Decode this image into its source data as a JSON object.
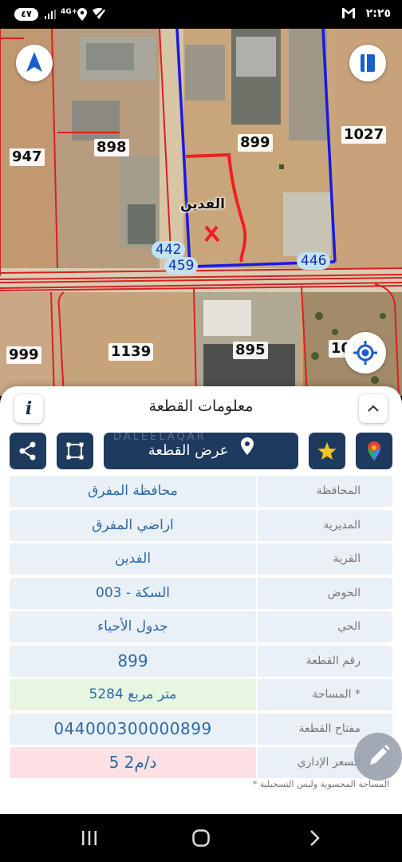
{
  "status_bar": {
    "time": "٢:٢٥",
    "battery": "٤٧",
    "network": "4G+",
    "icons": [
      "gmail-icon",
      "signal-icon",
      "location-icon",
      "wifi-off-icon"
    ]
  },
  "map": {
    "parcel_labels": [
      "947",
      "898",
      "899",
      "1027",
      "999",
      "1139",
      "895",
      "10"
    ],
    "village_label": "الفدين",
    "edge_labels": [
      "442",
      "459",
      "446"
    ],
    "colors": {
      "selected_parcel": "#ee2020",
      "boundary": "#1a1ae0",
      "parcel_lines": "#d82020",
      "edge_badge": "#bfe3f2"
    }
  },
  "sheet": {
    "title": "معلومات القطعة",
    "info_button": "i",
    "show_parcel_button": "عرض القطعة",
    "watermark": "DALEELAQAR",
    "rows": [
      {
        "label": "المحافظة",
        "value": "محافظة المفرق"
      },
      {
        "label": "المديرية",
        "value": "اراضي المفرق"
      },
      {
        "label": "القرية",
        "value": "الفدين"
      },
      {
        "label": "الحوض",
        "value": "السكة - 003"
      },
      {
        "label": "الحي",
        "value": "جدول الأحياء"
      },
      {
        "label": "رقم القطعة",
        "value": "899"
      },
      {
        "label": "المساحة *",
        "value": "5284  متر مربع"
      },
      {
        "label": "مفتاح القطعة",
        "value": "044000300000899"
      },
      {
        "label": "السعر الإداري",
        "value": "5 د/م2"
      }
    ],
    "footnote": "* المساحة المحسوبة وليس التسجيلية",
    "colors": {
      "button": "#1f3a5f",
      "row_bg": "#e9f0f6",
      "row_green": "#e6f6e1",
      "row_pink": "#fbe1e4",
      "value_text": "#2d6aa8",
      "star": "#f2c51c"
    }
  },
  "nav": {
    "icons": [
      "recent-apps-icon",
      "home-icon",
      "back-icon"
    ]
  }
}
